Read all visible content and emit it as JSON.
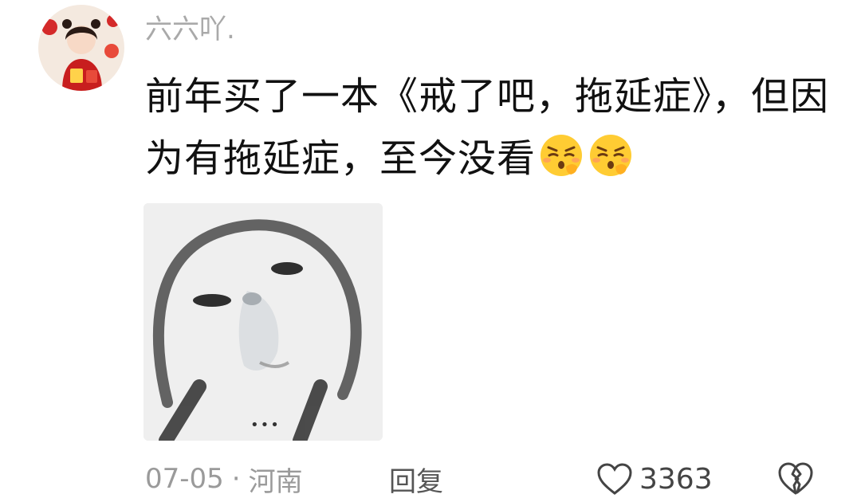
{
  "comment": {
    "username": "六六吖.",
    "text": "前年买了一本《戒了吧，拖延症》，但因为有拖延症，至今没看",
    "emojis": [
      "pensive-face-emoji",
      "pensive-face-emoji"
    ],
    "media": {
      "icon": "meme-face-image",
      "more_label": "•••"
    },
    "meta": {
      "date": "07-05",
      "separator": "·",
      "location": "河南",
      "reply_label": "回复",
      "like_count": "3363"
    }
  },
  "colors": {
    "username": "#a9a9a9",
    "text": "#111111",
    "meta": "#9a9a9a",
    "icons": "#444444"
  }
}
